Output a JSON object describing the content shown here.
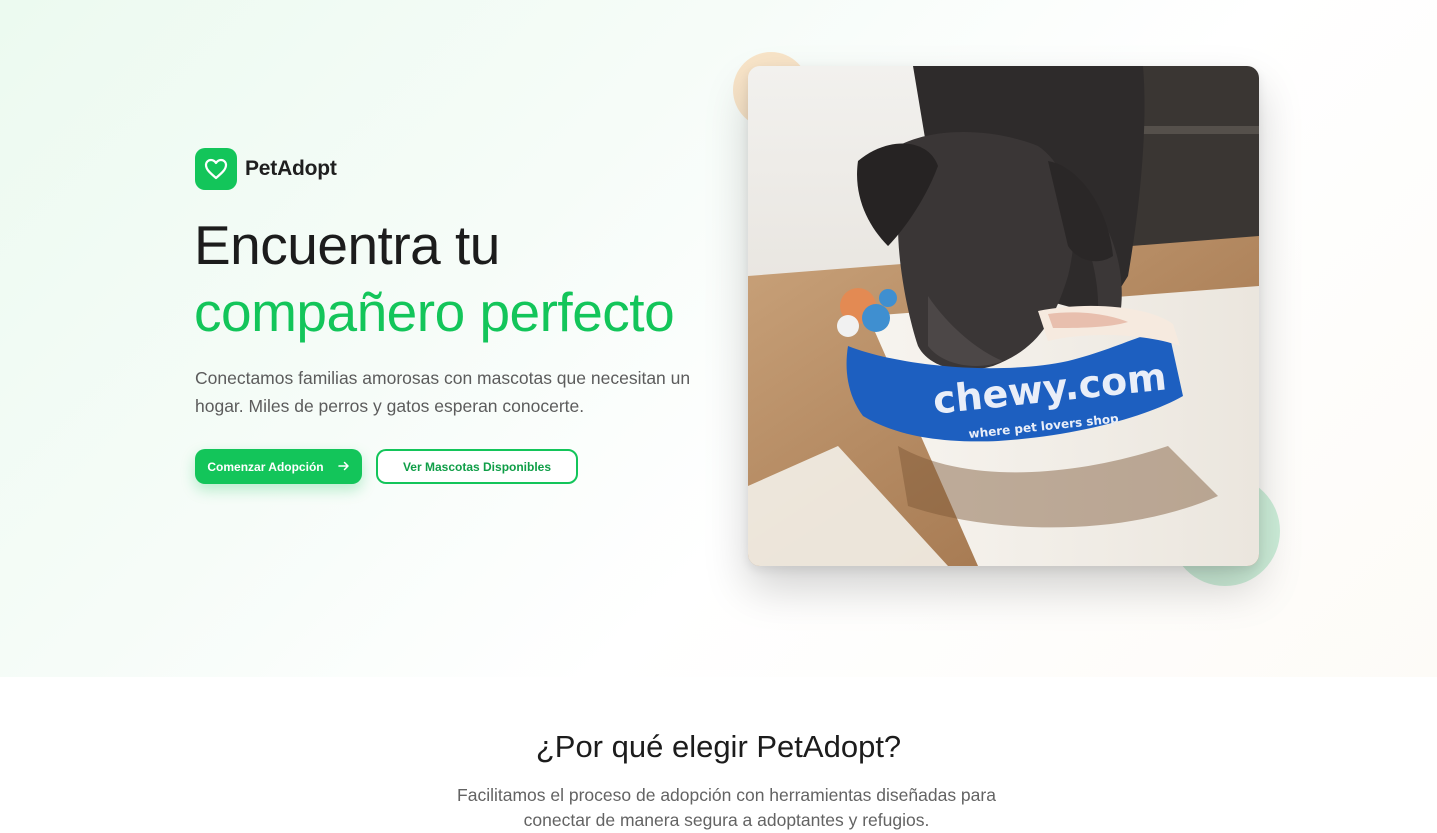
{
  "brand": {
    "name": "PetAdopt",
    "logo_icon": "heart-icon",
    "accent_color": "#13c55a"
  },
  "hero": {
    "headline_line1": "Encuentra tu",
    "headline_line2": "compañero perfecto",
    "subtitle": "Conectamos familias amorosas con mascotas que necesitan un hogar. Miles de perros y gatos esperan conocerte.",
    "primary_button": {
      "label": "Comenzar Adopción",
      "icon": "arrow-right-icon"
    },
    "secondary_button": {
      "label": "Ver Mascotas Disponibles"
    },
    "image": {
      "toy_brand": "chewy.com",
      "toy_tagline": "where pet lovers shop"
    }
  },
  "why_section": {
    "title": "¿Por qué elegir PetAdopt?",
    "description": "Facilitamos el proceso de adopción con herramientas diseñadas para conectar de manera segura a adoptantes y refugios."
  }
}
